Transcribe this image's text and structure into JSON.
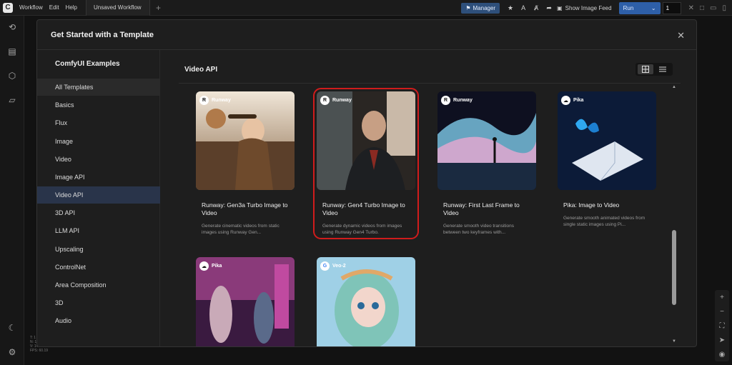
{
  "topbar": {
    "menu": [
      "Workflow",
      "Edit",
      "Help"
    ],
    "workflow_tab": "Unsaved Workflow",
    "manager_label": "Manager",
    "show_feed_label": "Show Image Feed",
    "run_label": "Run",
    "run_count": "1"
  },
  "stats": [
    "T: 1",
    "N: 1 [1]",
    "V: 14",
    "FPS: 60.19"
  ],
  "modal": {
    "title": "Get Started with a Template",
    "sidebar_title": "ComfyUI Examples",
    "nav": [
      "All Templates",
      "Basics",
      "Flux",
      "Image",
      "Video",
      "Image API",
      "Video API",
      "3D API",
      "LLM API",
      "Upscaling",
      "ControlNet",
      "Area Composition",
      "3D",
      "Audio"
    ],
    "active_nav": "Video API",
    "content_title": "Video API",
    "cards": [
      {
        "provider": "Runway",
        "title": "Runway: Gen3a Turbo Image to Video",
        "desc": "Generate cinematic videos from static images using Runway Gen..."
      },
      {
        "provider": "Runway",
        "title": "Runway: Gen4 Turbo Image to Video",
        "desc": "Generate dynamic videos from images using Runway Gen4 Turbo."
      },
      {
        "provider": "Runway",
        "title": "Runway: First Last Frame to Video",
        "desc": "Generate smooth video transitions between two keyframes with..."
      },
      {
        "provider": "Pika",
        "title": "Pika: Image to Video",
        "desc": "Generate smooth animated videos from single static images using Pi..."
      },
      {
        "provider": "Pika",
        "title": "",
        "desc": ""
      },
      {
        "provider": "Veo-2",
        "title": "",
        "desc": ""
      }
    ]
  },
  "colors": {
    "accent": "#2e5fa8",
    "selected_outline": "#d01c1c",
    "active_nav": "#29344a"
  }
}
